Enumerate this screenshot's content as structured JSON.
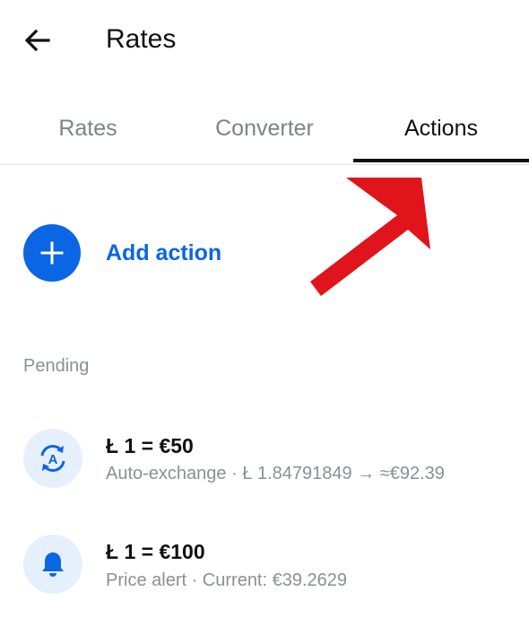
{
  "header": {
    "title": "Rates",
    "back_icon": "arrow-left-icon"
  },
  "tabs": [
    {
      "label": "Rates",
      "active": false
    },
    {
      "label": "Converter",
      "active": false
    },
    {
      "label": "Actions",
      "active": true
    }
  ],
  "add_action": {
    "label": "Add action",
    "icon": "plus-icon",
    "color": "#0b66e4"
  },
  "section": {
    "label": "Pending"
  },
  "items": [
    {
      "title": "Ł 1 = €50",
      "subtitle": "Auto-exchange · Ł 1.84791849 → ≈€92.39",
      "icon": "auto-exchange-icon"
    },
    {
      "title": "Ł 1 = €100",
      "subtitle": "Price alert · Current: €39.2629",
      "icon": "bell-icon"
    }
  ],
  "annotation": {
    "arrow_color": "#e0141a"
  }
}
